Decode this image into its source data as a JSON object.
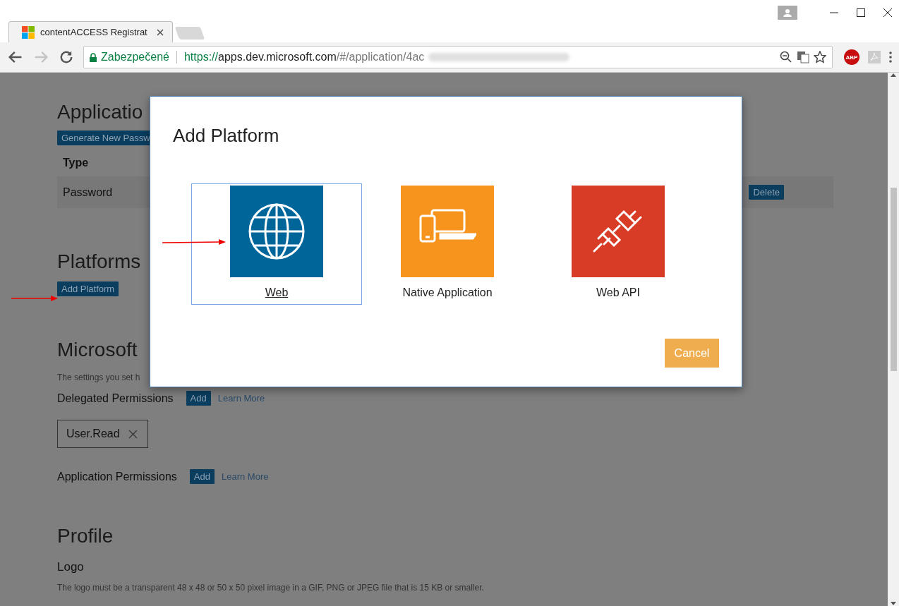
{
  "browser": {
    "tab": {
      "title": "contentACCESS Registrat"
    },
    "nav_buttons": [
      {
        "kind": "back",
        "disabled": false
      },
      {
        "kind": "forward",
        "disabled": true
      },
      {
        "kind": "reload",
        "disabled": false
      }
    ],
    "address_bar": {
      "security_label": "Zabezpečené",
      "url_scheme": "https://",
      "url_host": "apps.dev.microsoft.com",
      "url_path": "/#/application/4ac"
    },
    "adblock_badge": "ABP"
  },
  "page": {
    "app_secrets": {
      "heading": "Applicatio",
      "generate_button": "Generate New Passw",
      "type_header": "Type",
      "row_type": "Password",
      "delete_button": "Delete"
    },
    "platforms": {
      "heading": "Platforms",
      "add_button": "Add Platform"
    },
    "graph": {
      "heading": "Microsoft",
      "description": "The settings you set h",
      "delegated": {
        "label": "Delegated Permissions",
        "add_button": "Add",
        "link": "Learn More",
        "tags": [
          "User.Read"
        ]
      },
      "application": {
        "label": "Application Permissions",
        "add_button": "Add",
        "link": "Learn More"
      }
    },
    "profile": {
      "heading": "Profile",
      "logo_label": "Logo",
      "logo_hint": "The logo must be a transparent 48 x 48 or 50 x 50 pixel image in a GIF, PNG or JPEG file that is 15 KB or smaller."
    }
  },
  "dialog": {
    "title": "Add Platform",
    "tiles": [
      {
        "label": "Web",
        "kind": "globe",
        "color": "#00669a",
        "selected": true
      },
      {
        "label": "Native Application",
        "kind": "devices",
        "color": "#f7941e",
        "selected": false
      },
      {
        "label": "Web API",
        "kind": "plug",
        "color": "#d83c26",
        "selected": false
      }
    ],
    "cancel_button": "Cancel"
  }
}
